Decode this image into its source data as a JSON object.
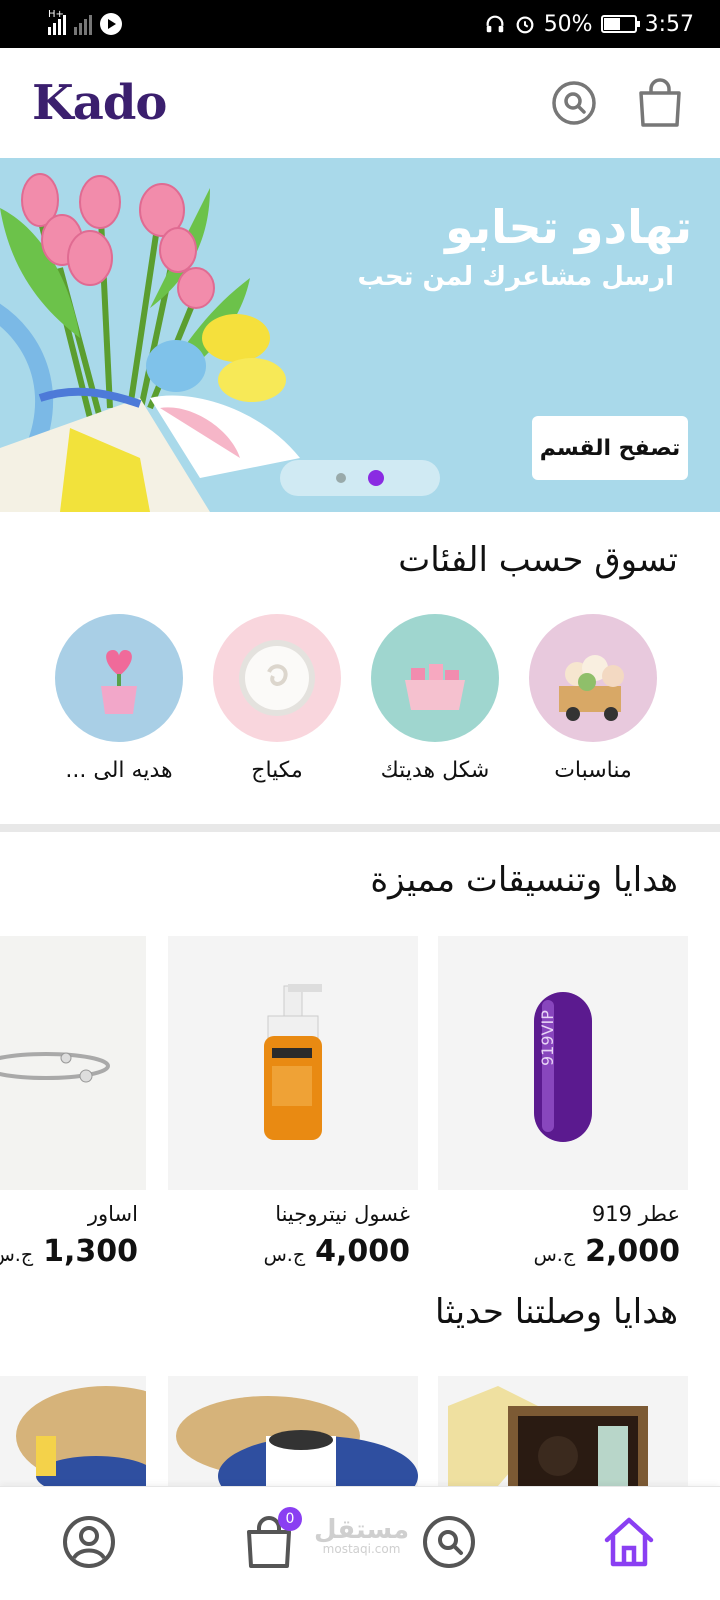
{
  "status_bar": {
    "battery": "50%",
    "time": "3:57",
    "signal_tag": "H+"
  },
  "header": {
    "logo": "Kado",
    "search_icon": "search-icon",
    "bag_icon": "shopping-bag-icon"
  },
  "banner": {
    "title": "تهادو تحابو",
    "subtitle": "ارسل مشاعرك لمن تحب",
    "cta": "تصفح القسم",
    "slides": 2,
    "active_slide": 2
  },
  "categories": {
    "title": "تسوق حسب الفئات",
    "items": [
      {
        "label": "مناسبات",
        "color": "#e8c9dd"
      },
      {
        "label": "شكل هديتك",
        "color": "#9fd6cf"
      },
      {
        "label": "مكياج",
        "color": "#f9d6dd"
      },
      {
        "label": "هديه الى ...",
        "color": "#a9cfe6"
      }
    ]
  },
  "featured": {
    "title": "هدايا وتنسيقات مميزة",
    "currency": "ج.س",
    "items": [
      {
        "name": "عطر 919",
        "price": "2,000"
      },
      {
        "name": "غسول نيتروجينا",
        "price": "4,000"
      },
      {
        "name": "اساور",
        "price": "1,300"
      }
    ]
  },
  "new_arrivals": {
    "title": "هدايا وصلتنا حديثا"
  },
  "bottom_nav": {
    "cart_count": "0",
    "watermark": "مستقل",
    "watermark_sub": "mostaqi.com",
    "active_color": "#8a3ff2"
  }
}
